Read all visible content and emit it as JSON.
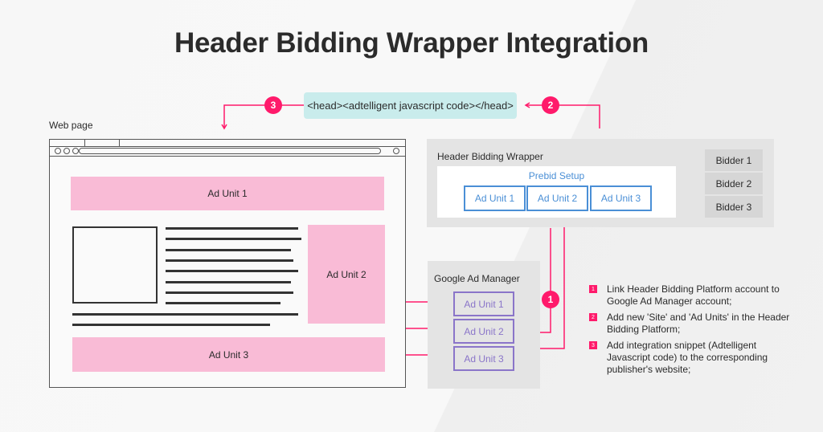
{
  "title": "Header Bidding Wrapper Integration",
  "code_snippet": "<head><adtelligent javascript code></head>",
  "web_page": {
    "label": "Web page",
    "ad_units": [
      "Ad Unit 1",
      "Ad Unit 2",
      "Ad Unit 3"
    ]
  },
  "header_bidding_wrapper": {
    "label": "Header Bidding Wrapper",
    "prebid_label": "Prebid Setup",
    "ad_units": [
      "Ad Unit 1",
      "Ad Unit 2",
      "Ad Unit 3"
    ],
    "bidders": [
      "Bidder 1",
      "Bidder 2",
      "Bidder 3"
    ]
  },
  "google_ad_manager": {
    "label": "Google Ad Manager",
    "ad_units": [
      "Ad Unit 1",
      "Ad Unit 2",
      "Ad Unit 3"
    ]
  },
  "flow_badges": [
    "1",
    "2",
    "3"
  ],
  "steps": [
    {
      "num": "1",
      "text": "Link Header Bidding Platform account to Google Ad Manager account;"
    },
    {
      "num": "2",
      "text": "Add new 'Site' and 'Ad Units' in the Header Bidding Platform;"
    },
    {
      "num": "3",
      "text": "Add integration snippet (Adtelligent Javascript code) to the corresponding publisher's website;"
    }
  ],
  "colors": {
    "accent": "#ff1a6b",
    "ad_pink": "#f9bbd6",
    "prebid_blue": "#4a8fd6",
    "gam_purple": "#8a75c9",
    "code_bg": "#c9ecec"
  }
}
